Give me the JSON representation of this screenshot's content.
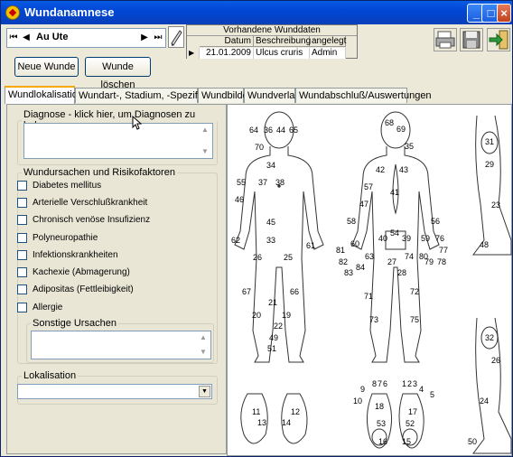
{
  "window": {
    "title": "Wundanamnese"
  },
  "navigator": {
    "first": "⏮",
    "prev": "◀",
    "next": "▶",
    "last": "⏭",
    "patient": "Au Ute"
  },
  "buttons": {
    "new_wound": "Neue Wunde",
    "delete_wound": "Wunde löschen"
  },
  "wound_table": {
    "caption": "Vorhandene Wunddaten",
    "headers": [
      "Datum",
      "Beschreibung",
      "angelegt"
    ],
    "rows": [
      {
        "marker": "▶",
        "date": "21.01.2009",
        "description": "Ulcus cruris",
        "created_by": "Admin"
      }
    ]
  },
  "toolbar": {
    "icons": [
      "print-icon",
      "save-icon",
      "exit-icon"
    ]
  },
  "tabs": [
    "Wundlokalisation",
    "Wundart-, Stadium, -Spezifikation",
    "Wundbilder",
    "Wundverlauf",
    "Wundabschluß/Auswertungen"
  ],
  "diagnose": {
    "legend": "Diagnose - klick hier, um Diagnosen zu laden"
  },
  "causes": {
    "legend": "Wundursachen und Risikofaktoren",
    "items": [
      "Diabetes mellitus",
      "Arterielle Verschlußkrankheit",
      "Chronisch venöse Insufizienz",
      "Polyneuropathie",
      "Infektionskrankheiten",
      "Kachexie (Abmagerung)",
      "Adipositas (Fettleibigkeit)",
      "Allergie"
    ],
    "other_legend": "Sonstige Ursachen"
  },
  "lokalisation": {
    "legend": "Lokalisation",
    "value": ""
  },
  "body_map": {
    "front": [
      "64",
      "36",
      "44",
      "65",
      "70",
      "34",
      "37",
      "38",
      "55",
      "46",
      "45",
      "62",
      "33",
      "61",
      "26",
      "25",
      "67",
      "66",
      "21",
      "20",
      "19",
      "22",
      "49",
      "51",
      "11",
      "12",
      "13",
      "14"
    ],
    "back": [
      "68",
      "69",
      "35",
      "42",
      "43",
      "57",
      "41",
      "47",
      "58",
      "56",
      "40",
      "54",
      "39",
      "59",
      "76",
      "81",
      "60",
      "77",
      "82",
      "63",
      "74",
      "80",
      "78",
      "79",
      "83",
      "84",
      "27",
      "28",
      "71",
      "72",
      "73",
      "75",
      "9",
      "8",
      "7",
      "6",
      "1",
      "2",
      "3",
      "4",
      "10",
      "18",
      "17",
      "5",
      "53",
      "52",
      "16",
      "15"
    ],
    "side_upper": [
      "31",
      "29",
      "23",
      "48"
    ],
    "side_lower": [
      "32",
      "26",
      "24",
      "50"
    ]
  },
  "colors": {
    "accent_tab": "#f7a900",
    "title_bar": "#0047d6",
    "panel": "#e9e6d6"
  }
}
